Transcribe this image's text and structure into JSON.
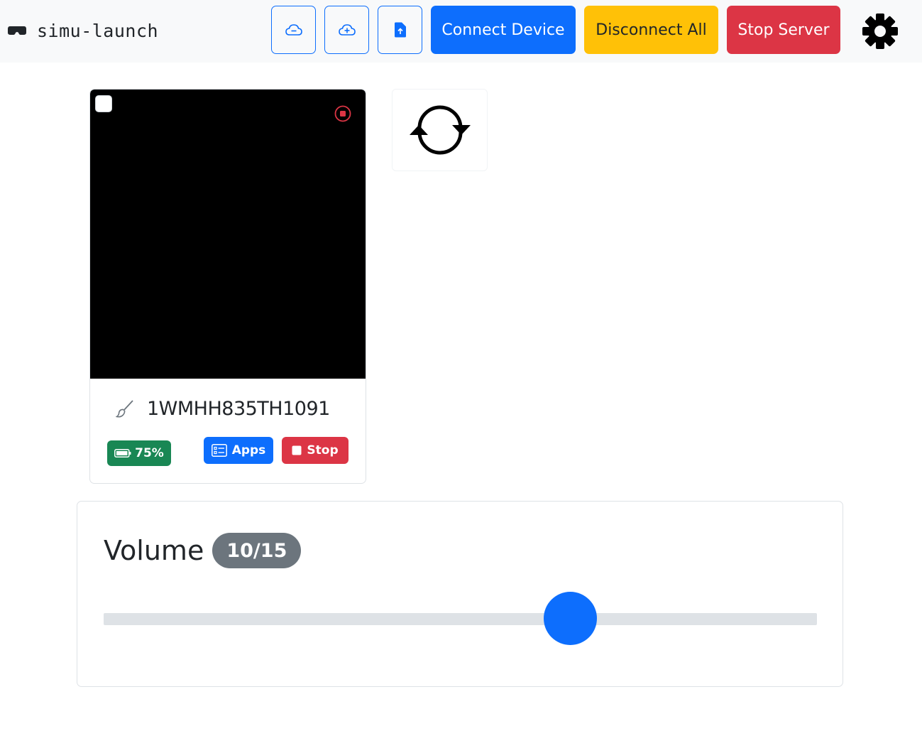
{
  "navbar": {
    "brand_icon": "vr-headset-icon",
    "brand_text": "simu-launch",
    "icon_buttons": [
      {
        "icon": "cloud-minus-icon"
      },
      {
        "icon": "cloud-plus-icon"
      },
      {
        "icon": "file-upload-icon"
      }
    ],
    "connect_label": "Connect Device",
    "disconnect_label": "Disconnect All",
    "stop_server_label": "Stop Server",
    "settings_icon": "gear-icon"
  },
  "device": {
    "name": "1WMHH835TH1091",
    "battery": "75%",
    "apps_label": "Apps",
    "stop_label": "Stop"
  },
  "refresh": {
    "icon": "refresh-icon"
  },
  "volume": {
    "label": "Volume",
    "badge": "10/15",
    "value": 10,
    "max": 15
  },
  "colors": {
    "primary": "#0d6efd",
    "warning": "#ffc107",
    "danger": "#dc3545",
    "success": "#198754",
    "secondary": "#6c757d"
  }
}
